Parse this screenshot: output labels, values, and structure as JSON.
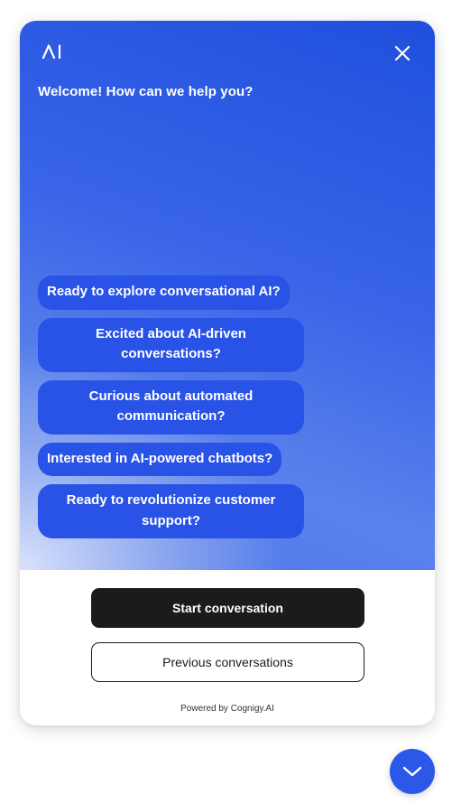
{
  "header": {
    "logo_text": "AI",
    "welcome": "Welcome! How can we help you?",
    "close_icon": "close-icon"
  },
  "suggestions": [
    {
      "label": "Ready to explore conversational AI?"
    },
    {
      "label": "Excited about AI-driven conversations?"
    },
    {
      "label": "Curious about automated communication?"
    },
    {
      "label": "Interested in AI-powered chatbots?"
    },
    {
      "label": "Ready to revolutionize customer support?"
    }
  ],
  "footer": {
    "start_label": "Start conversation",
    "previous_label": "Previous conversations",
    "powered_by": "Powered by Cognigy.AI"
  },
  "launcher": {
    "icon": "chevron-down-icon"
  },
  "colors": {
    "accent": "#2952e6",
    "primary_button": "#1b1b1b",
    "launcher": "#2b58e8"
  }
}
